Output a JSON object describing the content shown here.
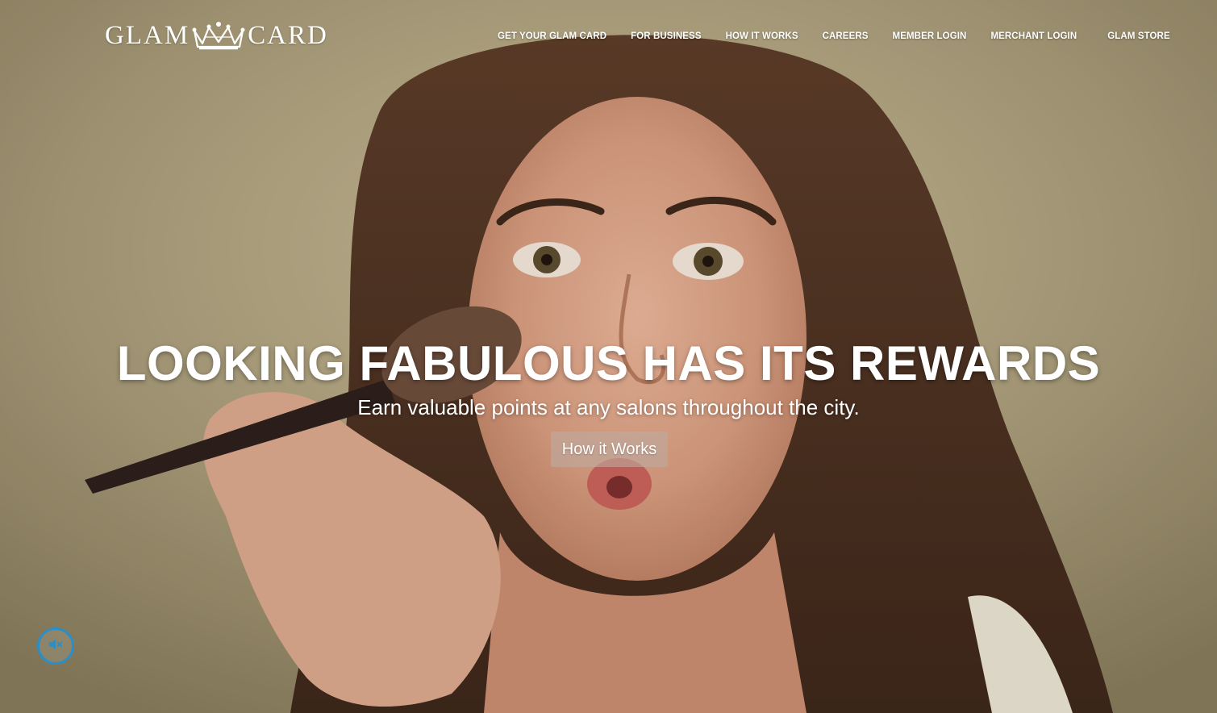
{
  "brand": {
    "logo_left": "GLAM",
    "logo_right": "CARD",
    "logo_icon": "crown-icon"
  },
  "nav": {
    "items": [
      {
        "label": "GET YOUR GLAM CARD"
      },
      {
        "label": "FOR BUSINESS"
      },
      {
        "label": "HOW IT WORKS"
      },
      {
        "label": "CAREERS"
      },
      {
        "label": "MEMBER LOGIN"
      },
      {
        "label": "MERCHANT LOGIN"
      },
      {
        "label": "GLAM STORE"
      }
    ]
  },
  "hero": {
    "headline": "LOOKING FABULOUS HAS ITS REWARDS",
    "subheadline": "Earn valuable points at any salons throughout the city.",
    "cta_label": "How it Works"
  },
  "controls": {
    "mute_icon": "muted-speaker-icon"
  },
  "colors": {
    "accent": "#2b8fc7",
    "text": "#ffffff"
  }
}
